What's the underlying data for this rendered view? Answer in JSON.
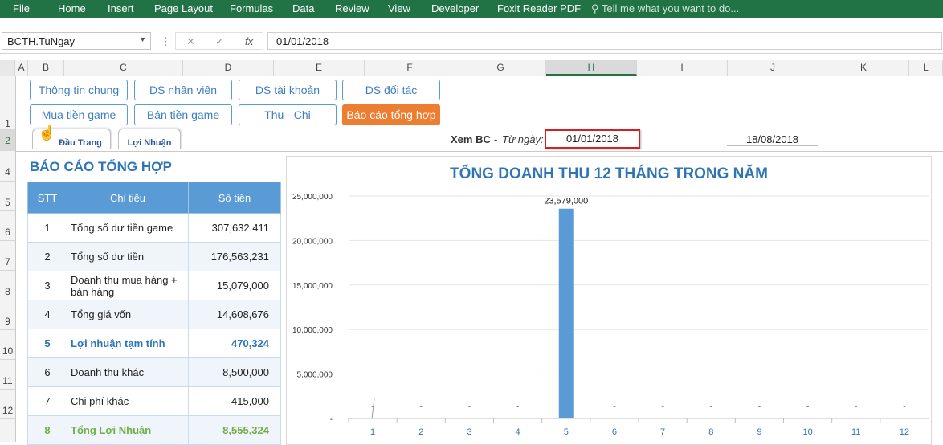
{
  "ribbon": {
    "tabs": [
      "File",
      "Home",
      "Insert",
      "Page Layout",
      "Formulas",
      "Data",
      "Review",
      "View",
      "Developer",
      "Foxit Reader PDF"
    ],
    "tell_me": "Tell me what you want to do..."
  },
  "formula_bar": {
    "name_box": "BCTH.TuNgay",
    "fx": "fx",
    "formula": "01/01/2018"
  },
  "columns": [
    "A",
    "B",
    "C",
    "D",
    "E",
    "F",
    "G",
    "H",
    "I",
    "J",
    "K",
    "L"
  ],
  "rows": [
    "1",
    "2",
    "4",
    "5",
    "6",
    "7",
    "8",
    "9",
    "10",
    "11",
    "12"
  ],
  "nav": {
    "row1": [
      "Thông tin chung",
      "DS nhân viên",
      "DS tài khoản",
      "DS đối tác"
    ],
    "row2": [
      "Mua tiền game",
      "Bán tiền game",
      "Thu - Chi",
      "Báo cáo tổng hợp"
    ]
  },
  "tabs": {
    "top": "Đầu Trang",
    "profit": "Lợi Nhuận"
  },
  "report": {
    "label": "Xem BC",
    "dash": "-",
    "from_label": "Từ ngày:",
    "from_date": "01/01/2018",
    "to_date": "18/08/2018"
  },
  "table": {
    "title": "BÁO CÁO TỔNG HỢP",
    "headers": [
      "STT",
      "Chỉ tiêu",
      "Số tiền"
    ],
    "rows": [
      {
        "stt": "1",
        "name": "Tổng số dư tiền game",
        "amount": "307,632,411",
        "style": "normal"
      },
      {
        "stt": "2",
        "name": "Tổng số dư tiền",
        "amount": "176,563,231",
        "style": "normal"
      },
      {
        "stt": "3",
        "name": "Doanh thu mua hàng + bán hàng",
        "amount": "15,079,000",
        "style": "normal"
      },
      {
        "stt": "4",
        "name": "Tổng giá vốn",
        "amount": "14,608,676",
        "style": "normal"
      },
      {
        "stt": "5",
        "name": "Lợi nhuận tạm tính",
        "amount": "470,324",
        "style": "blue"
      },
      {
        "stt": "6",
        "name": "Doanh thu khác",
        "amount": "8,500,000",
        "style": "normal"
      },
      {
        "stt": "7",
        "name": "Chi phí khác",
        "amount": "415,000",
        "style": "normal"
      },
      {
        "stt": "8",
        "name": "Tổng Lợi Nhuận",
        "amount": "8,555,324",
        "style": "green"
      }
    ]
  },
  "chart_data": {
    "type": "bar",
    "title": "TỔNG DOANH THU 12 THÁNG TRONG NĂM",
    "categories": [
      "1",
      "2",
      "3",
      "4",
      "5",
      "6",
      "7",
      "8",
      "9",
      "10",
      "11",
      "12"
    ],
    "values": [
      0,
      0,
      0,
      0,
      23579000,
      0,
      0,
      0,
      0,
      0,
      0,
      0
    ],
    "data_labels": [
      "-",
      "-",
      "-",
      "-",
      "23,579,000",
      "-",
      "-",
      "-",
      "-",
      "-",
      "-",
      "-"
    ],
    "ylim": [
      0,
      25000000
    ],
    "yticks": [
      "-",
      "5,000,000",
      "10,000,000",
      "15,000,000",
      "20,000,000",
      "25,000,000"
    ],
    "grid": true,
    "bar_color": "#5b9bd5",
    "label_color": "#2e75b6"
  },
  "colors": {
    "ribbon": "#217346",
    "accent_blue": "#5b9bd5",
    "active_orange": "#ed7d31"
  }
}
